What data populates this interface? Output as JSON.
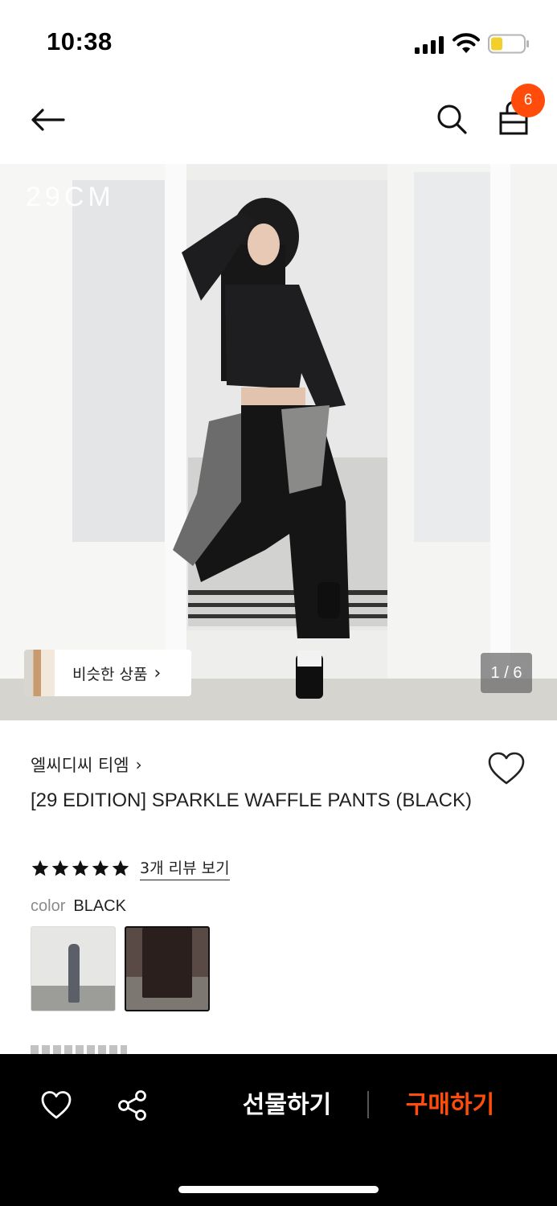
{
  "status_bar": {
    "time": "10:38"
  },
  "header": {
    "cart_count": "6"
  },
  "hero": {
    "logo": "29CM",
    "similar_label": "비슷한 상품",
    "page_indicator": "1 / 6"
  },
  "product": {
    "brand": "엘씨디씨 티엠",
    "title": "[29 EDITION] SPARKLE WAFFLE PANTS (BLACK)",
    "rating": 5,
    "review_link": "3개 리뷰 보기",
    "color_label": "color",
    "color_value": "BLACK"
  },
  "bottom_bar": {
    "gift_label": "선물하기",
    "buy_label": "구매하기"
  },
  "colors": {
    "accent": "#ff4c0a",
    "bar": "#000000"
  },
  "icons": [
    "back-arrow-icon",
    "search-icon",
    "shopping-bag-icon",
    "heart-icon",
    "share-icon",
    "star-icon",
    "chevron-right-icon"
  ]
}
